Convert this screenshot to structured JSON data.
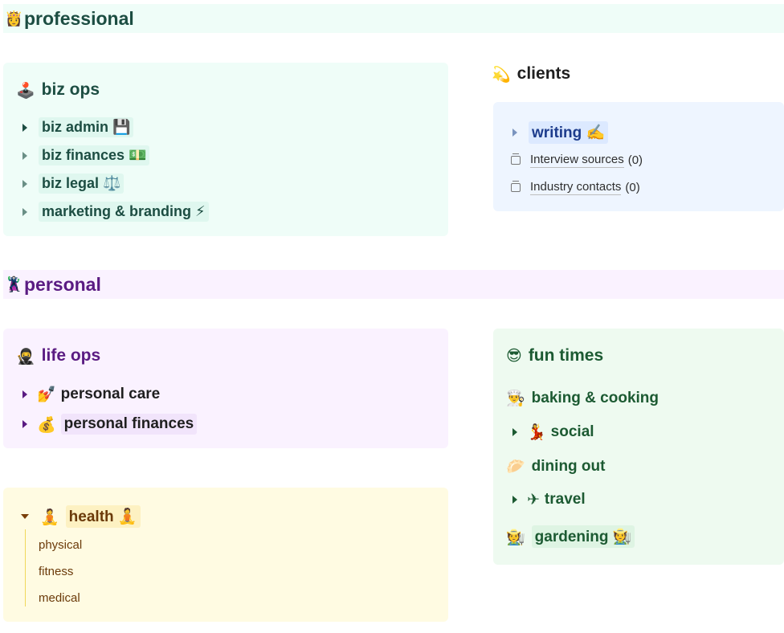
{
  "sections": {
    "professional": {
      "emoji": "👸",
      "title": "professional"
    },
    "personal": {
      "emoji": "🦹",
      "title": "personal"
    }
  },
  "biz_ops": {
    "emoji": "🕹️",
    "title": "biz ops",
    "items": [
      {
        "label": "biz admin",
        "icon": "💾"
      },
      {
        "label": "biz finances",
        "icon": "💵"
      },
      {
        "label": "biz legal",
        "icon": "⚖️"
      },
      {
        "label": "marketing & branding",
        "icon": "⚡"
      }
    ]
  },
  "clients": {
    "emoji": "💫",
    "title": "clients",
    "writing": {
      "label": "writing",
      "icon": "✍️"
    },
    "databases": [
      {
        "label": "Interview sources",
        "count": "(0)"
      },
      {
        "label": "Industry contacts",
        "count": "(0)"
      }
    ]
  },
  "life_ops": {
    "emoji": "🥷",
    "title": "life ops",
    "items": [
      {
        "label": "personal care",
        "icon": "💅"
      },
      {
        "label": "personal finances",
        "icon": "💰"
      }
    ]
  },
  "health": {
    "icon_left": "🧘",
    "label": "health",
    "icon_right": "🧘",
    "subitems": [
      "physical",
      "fitness",
      "medical"
    ]
  },
  "fun_times": {
    "emoji": "😎",
    "title": "fun times",
    "items": [
      {
        "icon": "👨‍🍳",
        "label": "baking & cooking"
      },
      {
        "icon": "💃",
        "label": "social"
      },
      {
        "icon": "🥟",
        "label": "dining out"
      },
      {
        "icon": "✈",
        "label": "travel"
      },
      {
        "icon": "🧑‍🌾",
        "label": "gardening",
        "icon_right": "🧑‍🌾"
      }
    ]
  },
  "colors": {
    "professional_bg": "#effdf8",
    "personal_bg": "#faf2ff",
    "clients_bg": "#eef5ff",
    "health_bg": "#fffbe2",
    "fun_bg": "#eefaf0"
  }
}
